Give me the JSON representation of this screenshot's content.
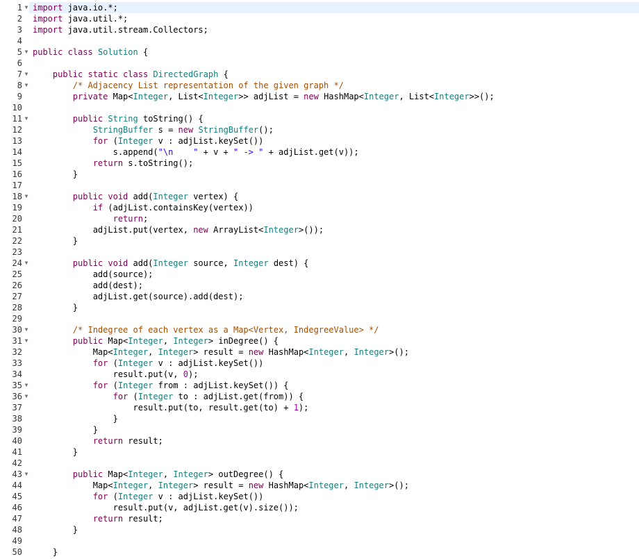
{
  "editor": {
    "active_line_index": 0,
    "colors": {
      "background": "#ffffff",
      "active_line": "#e8f2fe",
      "line_number": "#333333",
      "keyword": "#7f0055",
      "type": "#167f7f",
      "comment": "#a64e00",
      "string": "#2a00ff",
      "number": "#a300a3",
      "plain": "#000000"
    },
    "fold_icon": "chevron-down-icon",
    "lines": [
      {
        "number": "1",
        "fold": true,
        "tokens": [
          {
            "t": "import",
            "c": "keyword"
          },
          {
            "t": " java.io.*;",
            "c": "plain"
          }
        ]
      },
      {
        "number": "2",
        "fold": false,
        "tokens": [
          {
            "t": "import",
            "c": "keyword"
          },
          {
            "t": " java.util.*;",
            "c": "plain"
          }
        ]
      },
      {
        "number": "3",
        "fold": false,
        "tokens": [
          {
            "t": "import",
            "c": "keyword"
          },
          {
            "t": " java.util.stream.Collectors;",
            "c": "plain"
          }
        ]
      },
      {
        "number": "4",
        "fold": false,
        "tokens": []
      },
      {
        "number": "5",
        "fold": true,
        "tokens": [
          {
            "t": "public class",
            "c": "keyword"
          },
          {
            "t": " ",
            "c": "plain"
          },
          {
            "t": "Solution",
            "c": "type"
          },
          {
            "t": " {",
            "c": "plain"
          }
        ]
      },
      {
        "number": "6",
        "fold": false,
        "tokens": []
      },
      {
        "number": "7",
        "fold": true,
        "tokens": [
          {
            "t": "    ",
            "c": "plain"
          },
          {
            "t": "public static class",
            "c": "keyword"
          },
          {
            "t": " ",
            "c": "plain"
          },
          {
            "t": "DirectedGraph",
            "c": "type"
          },
          {
            "t": " {",
            "c": "plain"
          }
        ]
      },
      {
        "number": "8",
        "fold": true,
        "tokens": [
          {
            "t": "        ",
            "c": "plain"
          },
          {
            "t": "/* Adjacency List representation of the given graph */",
            "c": "comment"
          }
        ]
      },
      {
        "number": "9",
        "fold": false,
        "tokens": [
          {
            "t": "        ",
            "c": "plain"
          },
          {
            "t": "private",
            "c": "keyword"
          },
          {
            "t": " Map<",
            "c": "plain"
          },
          {
            "t": "Integer",
            "c": "type"
          },
          {
            "t": ", List<",
            "c": "plain"
          },
          {
            "t": "Integer",
            "c": "type"
          },
          {
            "t": ">> adjList = ",
            "c": "plain"
          },
          {
            "t": "new",
            "c": "keyword"
          },
          {
            "t": " HashMap<",
            "c": "plain"
          },
          {
            "t": "Integer",
            "c": "type"
          },
          {
            "t": ", List<",
            "c": "plain"
          },
          {
            "t": "Integer",
            "c": "type"
          },
          {
            "t": ">>();",
            "c": "plain"
          }
        ]
      },
      {
        "number": "10",
        "fold": false,
        "tokens": []
      },
      {
        "number": "11",
        "fold": true,
        "tokens": [
          {
            "t": "        ",
            "c": "plain"
          },
          {
            "t": "public",
            "c": "keyword"
          },
          {
            "t": " ",
            "c": "plain"
          },
          {
            "t": "String",
            "c": "type"
          },
          {
            "t": " toString() {",
            "c": "plain"
          }
        ]
      },
      {
        "number": "12",
        "fold": false,
        "tokens": [
          {
            "t": "            ",
            "c": "plain"
          },
          {
            "t": "StringBuffer",
            "c": "type"
          },
          {
            "t": " s = ",
            "c": "plain"
          },
          {
            "t": "new",
            "c": "keyword"
          },
          {
            "t": " ",
            "c": "plain"
          },
          {
            "t": "StringBuffer",
            "c": "type"
          },
          {
            "t": "();",
            "c": "plain"
          }
        ]
      },
      {
        "number": "13",
        "fold": false,
        "tokens": [
          {
            "t": "            ",
            "c": "plain"
          },
          {
            "t": "for",
            "c": "keyword"
          },
          {
            "t": " (",
            "c": "plain"
          },
          {
            "t": "Integer",
            "c": "type"
          },
          {
            "t": " v : adjList.keySet())",
            "c": "plain"
          }
        ]
      },
      {
        "number": "14",
        "fold": false,
        "tokens": [
          {
            "t": "                s.append(",
            "c": "plain"
          },
          {
            "t": "\"\\n    \"",
            "c": "string"
          },
          {
            "t": " + v + ",
            "c": "plain"
          },
          {
            "t": "\" -> \"",
            "c": "string"
          },
          {
            "t": " + adjList.get(v));",
            "c": "plain"
          }
        ]
      },
      {
        "number": "15",
        "fold": false,
        "tokens": [
          {
            "t": "            ",
            "c": "plain"
          },
          {
            "t": "return",
            "c": "keyword"
          },
          {
            "t": " s.toString();",
            "c": "plain"
          }
        ]
      },
      {
        "number": "16",
        "fold": false,
        "tokens": [
          {
            "t": "        }",
            "c": "plain"
          }
        ]
      },
      {
        "number": "17",
        "fold": false,
        "tokens": []
      },
      {
        "number": "18",
        "fold": true,
        "tokens": [
          {
            "t": "        ",
            "c": "plain"
          },
          {
            "t": "public void",
            "c": "keyword"
          },
          {
            "t": " add(",
            "c": "plain"
          },
          {
            "t": "Integer",
            "c": "type"
          },
          {
            "t": " vertex) {",
            "c": "plain"
          }
        ]
      },
      {
        "number": "19",
        "fold": false,
        "tokens": [
          {
            "t": "            ",
            "c": "plain"
          },
          {
            "t": "if",
            "c": "keyword"
          },
          {
            "t": " (adjList.containsKey(vertex))",
            "c": "plain"
          }
        ]
      },
      {
        "number": "20",
        "fold": false,
        "tokens": [
          {
            "t": "                ",
            "c": "plain"
          },
          {
            "t": "return",
            "c": "keyword"
          },
          {
            "t": ";",
            "c": "plain"
          }
        ]
      },
      {
        "number": "21",
        "fold": false,
        "tokens": [
          {
            "t": "            adjList.put(vertex, ",
            "c": "plain"
          },
          {
            "t": "new",
            "c": "keyword"
          },
          {
            "t": " ArrayList<",
            "c": "plain"
          },
          {
            "t": "Integer",
            "c": "type"
          },
          {
            "t": ">());",
            "c": "plain"
          }
        ]
      },
      {
        "number": "22",
        "fold": false,
        "tokens": [
          {
            "t": "        }",
            "c": "plain"
          }
        ]
      },
      {
        "number": "23",
        "fold": false,
        "tokens": []
      },
      {
        "number": "24",
        "fold": true,
        "tokens": [
          {
            "t": "        ",
            "c": "plain"
          },
          {
            "t": "public void",
            "c": "keyword"
          },
          {
            "t": " add(",
            "c": "plain"
          },
          {
            "t": "Integer",
            "c": "type"
          },
          {
            "t": " source, ",
            "c": "plain"
          },
          {
            "t": "Integer",
            "c": "type"
          },
          {
            "t": " dest) {",
            "c": "plain"
          }
        ]
      },
      {
        "number": "25",
        "fold": false,
        "tokens": [
          {
            "t": "            add(source);",
            "c": "plain"
          }
        ]
      },
      {
        "number": "26",
        "fold": false,
        "tokens": [
          {
            "t": "            add(dest);",
            "c": "plain"
          }
        ]
      },
      {
        "number": "27",
        "fold": false,
        "tokens": [
          {
            "t": "            adjList.get(source).add(dest);",
            "c": "plain"
          }
        ]
      },
      {
        "number": "28",
        "fold": false,
        "tokens": [
          {
            "t": "        }",
            "c": "plain"
          }
        ]
      },
      {
        "number": "29",
        "fold": false,
        "tokens": []
      },
      {
        "number": "30",
        "fold": true,
        "tokens": [
          {
            "t": "        ",
            "c": "plain"
          },
          {
            "t": "/* Indegree of each vertex as a Map<Vertex, IndegreeValue> */",
            "c": "comment"
          }
        ]
      },
      {
        "number": "31",
        "fold": true,
        "tokens": [
          {
            "t": "        ",
            "c": "plain"
          },
          {
            "t": "public",
            "c": "keyword"
          },
          {
            "t": " Map<",
            "c": "plain"
          },
          {
            "t": "Integer",
            "c": "type"
          },
          {
            "t": ", ",
            "c": "plain"
          },
          {
            "t": "Integer",
            "c": "type"
          },
          {
            "t": "> inDegree() {",
            "c": "plain"
          }
        ]
      },
      {
        "number": "32",
        "fold": false,
        "tokens": [
          {
            "t": "            Map<",
            "c": "plain"
          },
          {
            "t": "Integer",
            "c": "type"
          },
          {
            "t": ", ",
            "c": "plain"
          },
          {
            "t": "Integer",
            "c": "type"
          },
          {
            "t": "> result = ",
            "c": "plain"
          },
          {
            "t": "new",
            "c": "keyword"
          },
          {
            "t": " HashMap<",
            "c": "plain"
          },
          {
            "t": "Integer",
            "c": "type"
          },
          {
            "t": ", ",
            "c": "plain"
          },
          {
            "t": "Integer",
            "c": "type"
          },
          {
            "t": ">();",
            "c": "plain"
          }
        ]
      },
      {
        "number": "33",
        "fold": false,
        "tokens": [
          {
            "t": "            ",
            "c": "plain"
          },
          {
            "t": "for",
            "c": "keyword"
          },
          {
            "t": " (",
            "c": "plain"
          },
          {
            "t": "Integer",
            "c": "type"
          },
          {
            "t": " v : adjList.keySet())",
            "c": "plain"
          }
        ]
      },
      {
        "number": "34",
        "fold": false,
        "tokens": [
          {
            "t": "                result.put(v, ",
            "c": "plain"
          },
          {
            "t": "0",
            "c": "number"
          },
          {
            "t": ");",
            "c": "plain"
          }
        ]
      },
      {
        "number": "35",
        "fold": true,
        "tokens": [
          {
            "t": "            ",
            "c": "plain"
          },
          {
            "t": "for",
            "c": "keyword"
          },
          {
            "t": " (",
            "c": "plain"
          },
          {
            "t": "Integer",
            "c": "type"
          },
          {
            "t": " from : adjList.keySet()) {",
            "c": "plain"
          }
        ]
      },
      {
        "number": "36",
        "fold": true,
        "tokens": [
          {
            "t": "                ",
            "c": "plain"
          },
          {
            "t": "for",
            "c": "keyword"
          },
          {
            "t": " (",
            "c": "plain"
          },
          {
            "t": "Integer",
            "c": "type"
          },
          {
            "t": " to : adjList.get(from)) {",
            "c": "plain"
          }
        ]
      },
      {
        "number": "37",
        "fold": false,
        "tokens": [
          {
            "t": "                    result.put(to, result.get(to) + ",
            "c": "plain"
          },
          {
            "t": "1",
            "c": "number"
          },
          {
            "t": ");",
            "c": "plain"
          }
        ]
      },
      {
        "number": "38",
        "fold": false,
        "tokens": [
          {
            "t": "                }",
            "c": "plain"
          }
        ]
      },
      {
        "number": "39",
        "fold": false,
        "tokens": [
          {
            "t": "            }",
            "c": "plain"
          }
        ]
      },
      {
        "number": "40",
        "fold": false,
        "tokens": [
          {
            "t": "            ",
            "c": "plain"
          },
          {
            "t": "return",
            "c": "keyword"
          },
          {
            "t": " result;",
            "c": "plain"
          }
        ]
      },
      {
        "number": "41",
        "fold": false,
        "tokens": [
          {
            "t": "        }",
            "c": "plain"
          }
        ]
      },
      {
        "number": "42",
        "fold": false,
        "tokens": []
      },
      {
        "number": "43",
        "fold": true,
        "tokens": [
          {
            "t": "        ",
            "c": "plain"
          },
          {
            "t": "public",
            "c": "keyword"
          },
          {
            "t": " Map<",
            "c": "plain"
          },
          {
            "t": "Integer",
            "c": "type"
          },
          {
            "t": ", ",
            "c": "plain"
          },
          {
            "t": "Integer",
            "c": "type"
          },
          {
            "t": "> outDegree() {",
            "c": "plain"
          }
        ]
      },
      {
        "number": "44",
        "fold": false,
        "tokens": [
          {
            "t": "            Map<",
            "c": "plain"
          },
          {
            "t": "Integer",
            "c": "type"
          },
          {
            "t": ", ",
            "c": "plain"
          },
          {
            "t": "Integer",
            "c": "type"
          },
          {
            "t": "> result = ",
            "c": "plain"
          },
          {
            "t": "new",
            "c": "keyword"
          },
          {
            "t": " HashMap<",
            "c": "plain"
          },
          {
            "t": "Integer",
            "c": "type"
          },
          {
            "t": ", ",
            "c": "plain"
          },
          {
            "t": "Integer",
            "c": "type"
          },
          {
            "t": ">();",
            "c": "plain"
          }
        ]
      },
      {
        "number": "45",
        "fold": false,
        "tokens": [
          {
            "t": "            ",
            "c": "plain"
          },
          {
            "t": "for",
            "c": "keyword"
          },
          {
            "t": " (",
            "c": "plain"
          },
          {
            "t": "Integer",
            "c": "type"
          },
          {
            "t": " v : adjList.keySet())",
            "c": "plain"
          }
        ]
      },
      {
        "number": "46",
        "fold": false,
        "tokens": [
          {
            "t": "                result.put(v, adjList.get(v).size());",
            "c": "plain"
          }
        ]
      },
      {
        "number": "47",
        "fold": false,
        "tokens": [
          {
            "t": "            ",
            "c": "plain"
          },
          {
            "t": "return",
            "c": "keyword"
          },
          {
            "t": " result;",
            "c": "plain"
          }
        ]
      },
      {
        "number": "48",
        "fold": false,
        "tokens": [
          {
            "t": "        }",
            "c": "plain"
          }
        ]
      },
      {
        "number": "49",
        "fold": false,
        "tokens": []
      },
      {
        "number": "50",
        "fold": false,
        "tokens": [
          {
            "t": "    }",
            "c": "plain"
          }
        ]
      }
    ]
  }
}
